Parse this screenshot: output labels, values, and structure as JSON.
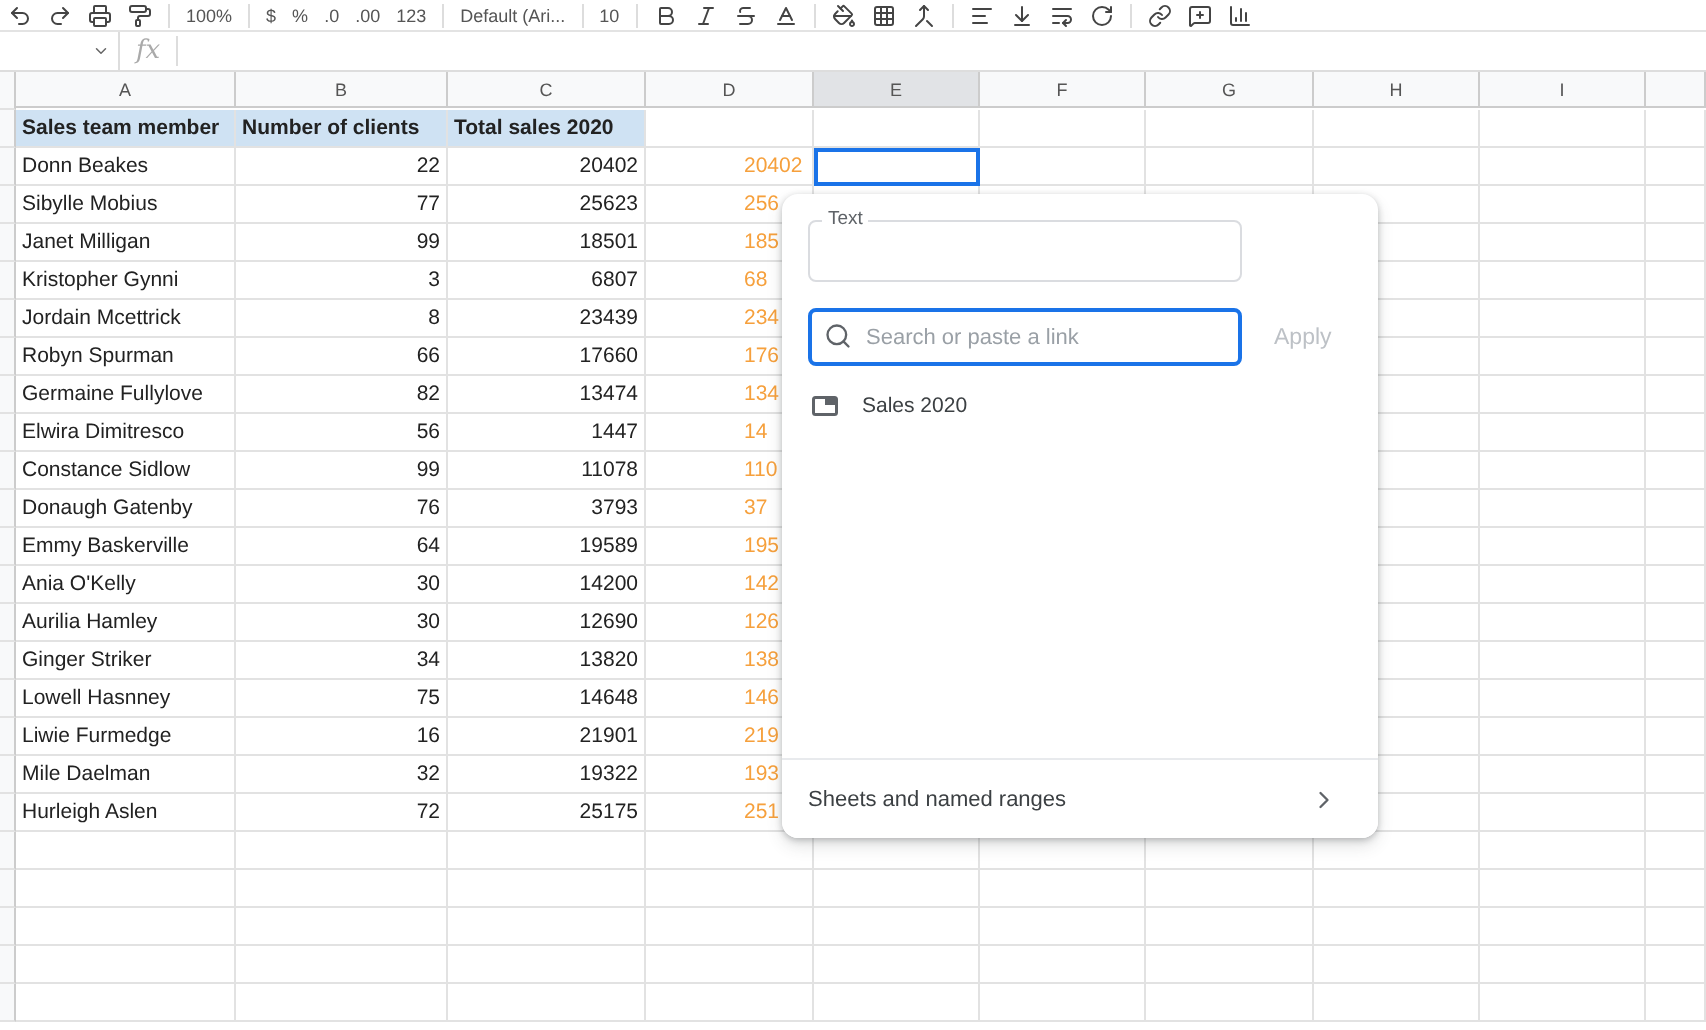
{
  "toolbar": {
    "zoom": "100%",
    "currency": "$",
    "percent": "%",
    "decimal_less": ".0",
    "decimal_more": ".00",
    "number_format": "123",
    "font": "Default (Ari...",
    "font_size": "10"
  },
  "formula_bar": {
    "fx": "fx"
  },
  "columns": [
    {
      "label": "A",
      "selected": false
    },
    {
      "label": "B",
      "selected": false
    },
    {
      "label": "C",
      "selected": false
    },
    {
      "label": "D",
      "selected": false
    },
    {
      "label": "E",
      "selected": true
    },
    {
      "label": "F",
      "selected": false
    },
    {
      "label": "G",
      "selected": false
    },
    {
      "label": "H",
      "selected": false
    },
    {
      "label": "I",
      "selected": false
    }
  ],
  "headers": [
    "Sales team member",
    "Number of clients",
    "Total sales 2020"
  ],
  "rows": [
    {
      "name": "Donn Beakes",
      "clients": "22",
      "sales": "20402",
      "column_d": "20402"
    },
    {
      "name": "Sibylle Mobius",
      "clients": "77",
      "sales": "25623",
      "column_d": "256"
    },
    {
      "name": "Janet Milligan",
      "clients": "99",
      "sales": "18501",
      "column_d": "185"
    },
    {
      "name": "Kristopher Gynni",
      "clients": "3",
      "sales": "6807",
      "column_d": "68"
    },
    {
      "name": "Jordain Mcettrick",
      "clients": "8",
      "sales": "23439",
      "column_d": "234"
    },
    {
      "name": "Robyn Spurman",
      "clients": "66",
      "sales": "17660",
      "column_d": "176"
    },
    {
      "name": "Germaine Fullylove",
      "clients": "82",
      "sales": "13474",
      "column_d": "134"
    },
    {
      "name": "Elwira Dimitresco",
      "clients": "56",
      "sales": "1447",
      "column_d": "14"
    },
    {
      "name": "Constance Sidlow",
      "clients": "99",
      "sales": "11078",
      "column_d": "110"
    },
    {
      "name": "Donaugh Gatenby",
      "clients": "76",
      "sales": "3793",
      "column_d": "37"
    },
    {
      "name": "Emmy Baskerville",
      "clients": "64",
      "sales": "19589",
      "column_d": "195"
    },
    {
      "name": "Ania O'Kelly",
      "clients": "30",
      "sales": "14200",
      "column_d": "142"
    },
    {
      "name": "Aurilia Hamley",
      "clients": "30",
      "sales": "12690",
      "column_d": "126"
    },
    {
      "name": "Ginger Striker",
      "clients": "34",
      "sales": "13820",
      "column_d": "138"
    },
    {
      "name": "Lowell Hasnney",
      "clients": "75",
      "sales": "14648",
      "column_d": "146"
    },
    {
      "name": "Liwie Furmedge",
      "clients": "16",
      "sales": "21901",
      "column_d": "219"
    },
    {
      "name": "Mile Daelman",
      "clients": "32",
      "sales": "19322",
      "column_d": "193"
    },
    {
      "name": "Hurleigh Aslen",
      "clients": "72",
      "sales": "25175",
      "column_d": "251"
    }
  ],
  "link_dialog": {
    "text_label": "Text",
    "search_placeholder": "Search or paste a link",
    "apply": "Apply",
    "suggestions": [
      {
        "label": "Sales 2020"
      }
    ],
    "footer": "Sheets and named ranges"
  }
}
